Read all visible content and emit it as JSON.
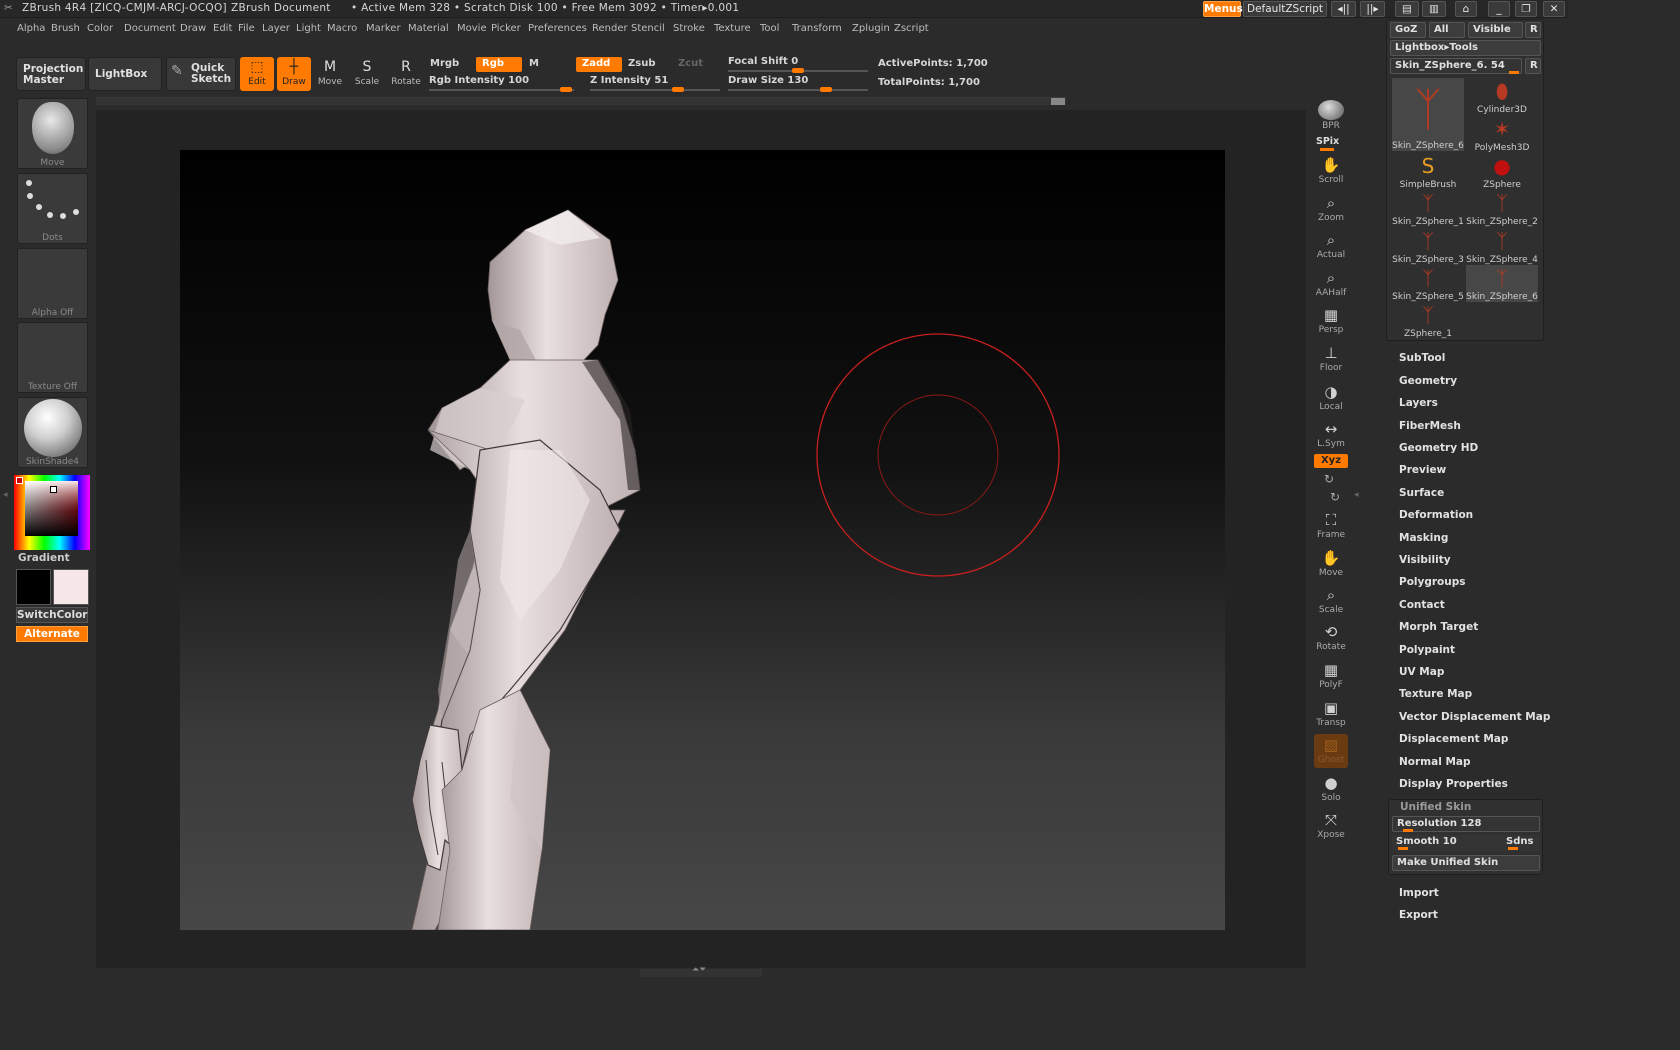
{
  "titlebar": {
    "app": "ZBrush 4R4 [ZICQ-CMJM-ARCJ-OCQO]",
    "doc": "ZBrush Document",
    "mem": "• Active Mem 328 • Scratch Disk 100 • Free Mem 3092 • Timer▸0.001",
    "menus_btn": "Menus",
    "script_btn": "DefaultZScript"
  },
  "menubar": [
    "Alpha",
    "Brush",
    "Color",
    "Document",
    "Draw",
    "Edit",
    "File",
    "Layer",
    "Light",
    "Macro",
    "Marker",
    "Material",
    "Movie",
    "Picker",
    "Preferences",
    "Render",
    "Stencil",
    "Stroke",
    "Texture",
    "Tool",
    "Transform",
    "Zplugin",
    "Zscript"
  ],
  "toolbar": {
    "projection_master": "Projection Master",
    "lightbox": "LightBox",
    "quick_sketch": "Quick Sketch",
    "edit": "Edit",
    "draw": "Draw",
    "move": "Move",
    "scale": "Scale",
    "rotate": "Rotate",
    "mrgb": "Mrgb",
    "rgb": "Rgb",
    "m": "M",
    "zadd": "Zadd",
    "zsub": "Zsub",
    "zcut": "Zcut",
    "rgb_intensity": "Rgb Intensity 100",
    "z_intensity": "Z Intensity 51",
    "focal_shift": "Focal Shift 0",
    "draw_size": "Draw Size 130",
    "active_points": "ActivePoints: 1,700",
    "total_points": "TotalPoints: 1,700"
  },
  "leftshelf": {
    "brush": "Move",
    "stroke": "Dots",
    "alpha": "Alpha Off",
    "texture": "Texture Off",
    "material": "SkinShade4",
    "gradient": "Gradient",
    "switchcolor": "SwitchColor",
    "alternate": "Alternate"
  },
  "rightshelf": [
    "BPR",
    "SPix",
    "Scroll",
    "Zoom",
    "Actual",
    "AAHalf",
    "Persp",
    "Floor",
    "Local",
    "L.Sym",
    "Xyz",
    "Frame",
    "Move",
    "Scale",
    "Rotate",
    "PolyF",
    "Transp",
    "Ghost",
    "Solo",
    "Xpose"
  ],
  "toolpanel": {
    "goz": "GoZ",
    "all": "All",
    "visible": "Visible",
    "r": "R",
    "lightbox_tools": "Lightbox▸Tools",
    "current_tool": "Skin_ZSphere_6. 54",
    "tools": [
      "Skin_ZSphere_6",
      "Cylinder3D",
      "SimpleBrush",
      "PolyMesh3D",
      "Skin_ZSphere_1",
      "ZSphere",
      "Skin_ZSphere_3",
      "Skin_ZSphere_2",
      "Skin_ZSphere_5",
      "Skin_ZSphere_4",
      "ZSphere_1",
      "Skin_ZSphere_6"
    ]
  },
  "subpalettes": [
    "SubTool",
    "Geometry",
    "Layers",
    "FiberMesh",
    "Geometry HD",
    "Preview",
    "Surface",
    "Deformation",
    "Masking",
    "Visibility",
    "Polygroups",
    "Contact",
    "Morph Target",
    "Polypaint",
    "UV Map",
    "Texture Map",
    "Vector Displacement Map",
    "Displacement Map",
    "Normal Map",
    "Display Properties"
  ],
  "unified_skin": {
    "title": "Unified Skin",
    "resolution": "Resolution 128",
    "smooth": "Smooth 10",
    "sdns": "Sdns",
    "make": "Make Unified Skin"
  },
  "bottom_subpalettes": [
    "Import",
    "Export"
  ],
  "colors": {
    "accent": "#ff7a00",
    "brush_circle": "#c8201e"
  }
}
